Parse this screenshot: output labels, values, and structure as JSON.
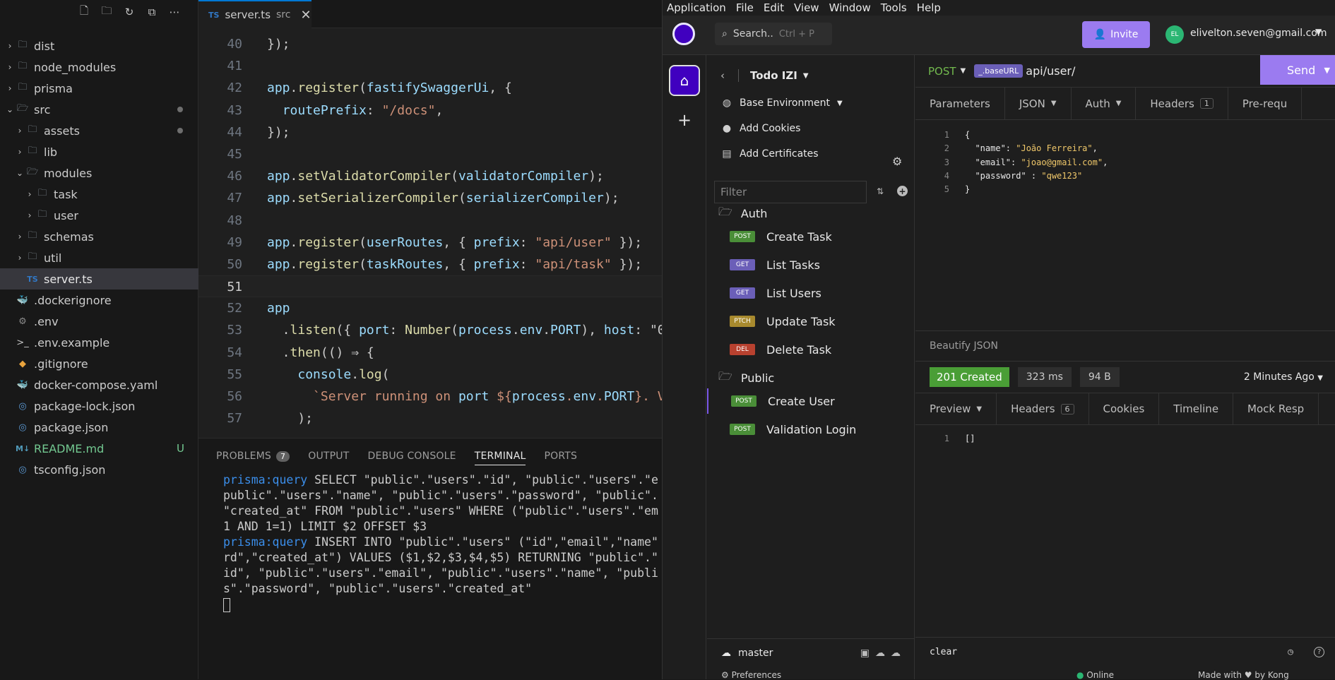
{
  "explorer": {
    "items": [
      {
        "label": "dist",
        "indent": 0,
        "chevron": "›",
        "icon": "folder-icon"
      },
      {
        "label": "node_modules",
        "indent": 0,
        "chevron": "›",
        "icon": "folder-icon"
      },
      {
        "label": "prisma",
        "indent": 0,
        "chevron": "›",
        "icon": "folder-icon"
      },
      {
        "label": "src",
        "indent": 0,
        "chevron": "⌄",
        "icon": "folder-open-icon"
      },
      {
        "label": "assets",
        "indent": 1,
        "chevron": "›",
        "icon": "folder-icon"
      },
      {
        "label": "lib",
        "indent": 1,
        "chevron": "›",
        "icon": "folder-icon"
      },
      {
        "label": "modules",
        "indent": 1,
        "chevron": "⌄",
        "icon": "folder-open-icon"
      },
      {
        "label": "task",
        "indent": 2,
        "chevron": "›",
        "icon": "folder-icon"
      },
      {
        "label": "user",
        "indent": 2,
        "chevron": "›",
        "icon": "folder-icon"
      },
      {
        "label": "schemas",
        "indent": 1,
        "chevron": "›",
        "icon": "folder-icon"
      },
      {
        "label": "util",
        "indent": 1,
        "chevron": "›",
        "icon": "folder-icon"
      },
      {
        "label": "server.ts",
        "indent": 1,
        "chevron": "",
        "icon": "typescript-file-icon",
        "badge_text": "TS"
      },
      {
        "label": ".dockerignore",
        "indent": 0,
        "chevron": "",
        "icon": "docker-file-icon"
      },
      {
        "label": ".env",
        "indent": 0,
        "chevron": "",
        "icon": "gear-file-icon"
      },
      {
        "label": ".env.example",
        "indent": 0,
        "chevron": "",
        "icon": "terminal-file-icon"
      },
      {
        "label": ".gitignore",
        "indent": 0,
        "chevron": "",
        "icon": "git-file-icon"
      },
      {
        "label": "docker-compose.yaml",
        "indent": 0,
        "chevron": "",
        "icon": "docker-file-icon"
      },
      {
        "label": "package-lock.json",
        "indent": 0,
        "chevron": "",
        "icon": "json-file-icon"
      },
      {
        "label": "package.json",
        "indent": 0,
        "chevron": "",
        "icon": "json-file-icon"
      },
      {
        "label": "README.md",
        "indent": 0,
        "chevron": "",
        "icon": "markdown-file-icon",
        "badge_text": "M↓",
        "flag": "U"
      },
      {
        "label": "tsconfig.json",
        "indent": 0,
        "chevron": "",
        "icon": "json-file-icon"
      }
    ],
    "flag_u": "U"
  },
  "editor": {
    "tab": {
      "badge": "TS",
      "filename": "server.ts",
      "dir": "src",
      "close": "✕"
    },
    "lines": [
      {
        "n": "40",
        "text": "});"
      },
      {
        "n": "41",
        "text": ""
      },
      {
        "n": "42",
        "text": "app.register(fastifySwaggerUi, {"
      },
      {
        "n": "43",
        "text": "  routePrefix: \"/docs\","
      },
      {
        "n": "44",
        "text": "});"
      },
      {
        "n": "45",
        "text": ""
      },
      {
        "n": "46",
        "text": "app.setValidatorCompiler(validatorCompiler);"
      },
      {
        "n": "47",
        "text": "app.setSerializerCompiler(serializerCompiler);"
      },
      {
        "n": "48",
        "text": ""
      },
      {
        "n": "49",
        "text": "app.register(userRoutes, { prefix: \"api/user\" });"
      },
      {
        "n": "50",
        "text": "app.register(taskRoutes, { prefix: \"api/task\" });"
      },
      {
        "n": "51",
        "text": ""
      },
      {
        "n": "52",
        "text": "app"
      },
      {
        "n": "53",
        "text": "  .listen({ port: Number(process.env.PORT), host: \"0"
      },
      {
        "n": "54",
        "text": "  .then(() ⇒ {"
      },
      {
        "n": "55",
        "text": "    console.log("
      },
      {
        "n": "56",
        "text": "      `Server running on port ${process.env.PORT}. V"
      },
      {
        "n": "57",
        "text": "    );"
      }
    ]
  },
  "panel": {
    "tabs": [
      "PROBLEMS",
      "OUTPUT",
      "DEBUG CONSOLE",
      "TERMINAL",
      "PORTS"
    ],
    "problems_count": "7",
    "active_tab": "TERMINAL",
    "terminal_lines": [
      {
        "prefix": "prisma:query",
        "text": " SELECT \"public\".\"users\".\"id\", \"public\".\"users\".\"e"
      },
      {
        "prefix": "",
        "text": "public\".\"users\".\"name\", \"public\".\"users\".\"password\", \"public\"."
      },
      {
        "prefix": "",
        "text": "\"created_at\" FROM \"public\".\"users\" WHERE (\"public\".\"users\".\"em"
      },
      {
        "prefix": "",
        "text": "1 AND 1=1) LIMIT $2 OFFSET $3"
      },
      {
        "prefix": "prisma:query",
        "text": " INSERT INTO \"public\".\"users\" (\"id\",\"email\",\"name\""
      },
      {
        "prefix": "",
        "text": "rd\",\"created_at\") VALUES ($1,$2,$3,$4,$5) RETURNING \"public\".\""
      },
      {
        "prefix": "",
        "text": "id\", \"public\".\"users\".\"email\", \"public\".\"users\".\"name\", \"publi"
      },
      {
        "prefix": "",
        "text": "s\".\"password\", \"public\".\"users\".\"created_at\""
      }
    ]
  },
  "insomnia": {
    "menu": [
      "Application",
      "File",
      "Edit",
      "View",
      "Window",
      "Tools",
      "Help"
    ],
    "search": {
      "label": "Search..",
      "shortcut": "Ctrl + P"
    },
    "invite_label": "Invite",
    "avatar_initials": "EL",
    "user_email": "elivelton.seven@gmail.com",
    "workspace": "Todo IZI",
    "environment": "Base Environment",
    "add_cookies": "Add Cookies",
    "add_certificates": "Add Certificates",
    "filter_placeholder": "Filter",
    "folders": [
      {
        "name": "Auth",
        "requests": [
          {
            "method": "POST",
            "name": "Create Task",
            "cls": "b-post"
          },
          {
            "method": "GET",
            "name": "List Tasks",
            "cls": "b-get"
          },
          {
            "method": "GET",
            "name": "List Users",
            "cls": "b-get"
          },
          {
            "method": "PTCH",
            "name": "Update Task",
            "cls": "b-ptch"
          },
          {
            "method": "DEL",
            "name": "Delete Task",
            "cls": "b-del"
          }
        ]
      },
      {
        "name": "Public",
        "requests": [
          {
            "method": "POST",
            "name": "Create User",
            "cls": "b-post",
            "active": true
          },
          {
            "method": "POST",
            "name": "Validation Login",
            "cls": "b-post"
          }
        ]
      }
    ],
    "branch": "master",
    "preferences": "Preferences",
    "request": {
      "method": "POST",
      "base_url_tag": "_.baseURL",
      "path": "api/user/",
      "send_label": "Send",
      "tabs": [
        {
          "label": "Parameters"
        },
        {
          "label": "JSON",
          "dropdown": true
        },
        {
          "label": "Auth",
          "dropdown": true
        },
        {
          "label": "Headers",
          "count": "1"
        },
        {
          "label": "Pre-requ"
        }
      ],
      "body_lines": [
        {
          "n": "1",
          "parts": [
            [
              "p",
              "{"
            ]
          ]
        },
        {
          "n": "2",
          "parts": [
            [
              "k",
              "  \"name\": "
            ],
            [
              "v",
              "\"João Ferreira\""
            ],
            [
              "p",
              ","
            ]
          ]
        },
        {
          "n": "3",
          "parts": [
            [
              "k",
              "  \"email\": "
            ],
            [
              "v",
              "\"joao@gmail.com\""
            ],
            [
              "p",
              ","
            ]
          ]
        },
        {
          "n": "4",
          "parts": [
            [
              "k",
              "  \"password\" : "
            ],
            [
              "v",
              "\"qwe123\""
            ]
          ]
        },
        {
          "n": "5",
          "parts": [
            [
              "p",
              "}"
            ]
          ]
        }
      ],
      "beautify": "Beautify JSON"
    },
    "response": {
      "status": "201 Created",
      "time": "323 ms",
      "size": "94 B",
      "ago": "2 Minutes Ago",
      "tabs": [
        {
          "label": "Preview",
          "dropdown": true
        },
        {
          "label": "Headers",
          "count": "6"
        },
        {
          "label": "Cookies"
        },
        {
          "label": "Timeline"
        },
        {
          "label": "Mock Resp"
        }
      ],
      "body_line_n": "1",
      "body": "[]",
      "filter_value": "clear"
    },
    "online": "Online",
    "made_with": "Made with ♥ by Kong"
  }
}
